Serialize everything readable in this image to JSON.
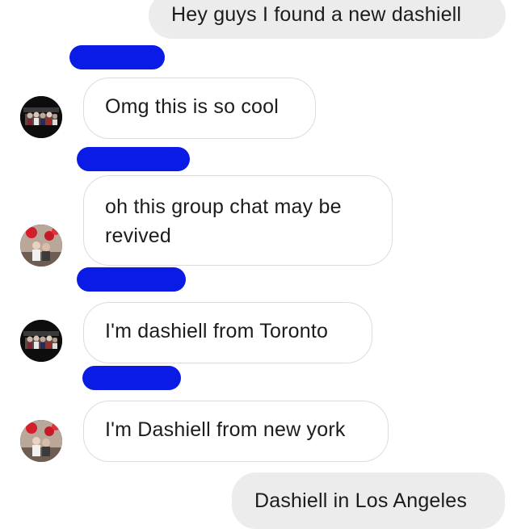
{
  "messages": [
    {
      "sender": "self",
      "text": "Hey guys I found a new dashiell"
    },
    {
      "sender": "other",
      "avatar": "avatar-dark-group-photo",
      "text": "Omg this is so cool"
    },
    {
      "sender": "other",
      "avatar": "avatar-balloons-photo",
      "text": "oh this group chat may be revived"
    },
    {
      "sender": "other",
      "avatar": "avatar-dark-group-photo",
      "text": "I'm dashiell from Toronto"
    },
    {
      "sender": "other",
      "avatar": "avatar-balloons-photo",
      "text": "I'm Dashiell from new york"
    },
    {
      "sender": "self",
      "text": "Dashiell in Los Angeles"
    }
  ],
  "colors": {
    "redaction": "#0a1be6",
    "sent_bubble": "#ececec",
    "received_border": "#dcdcdc"
  }
}
